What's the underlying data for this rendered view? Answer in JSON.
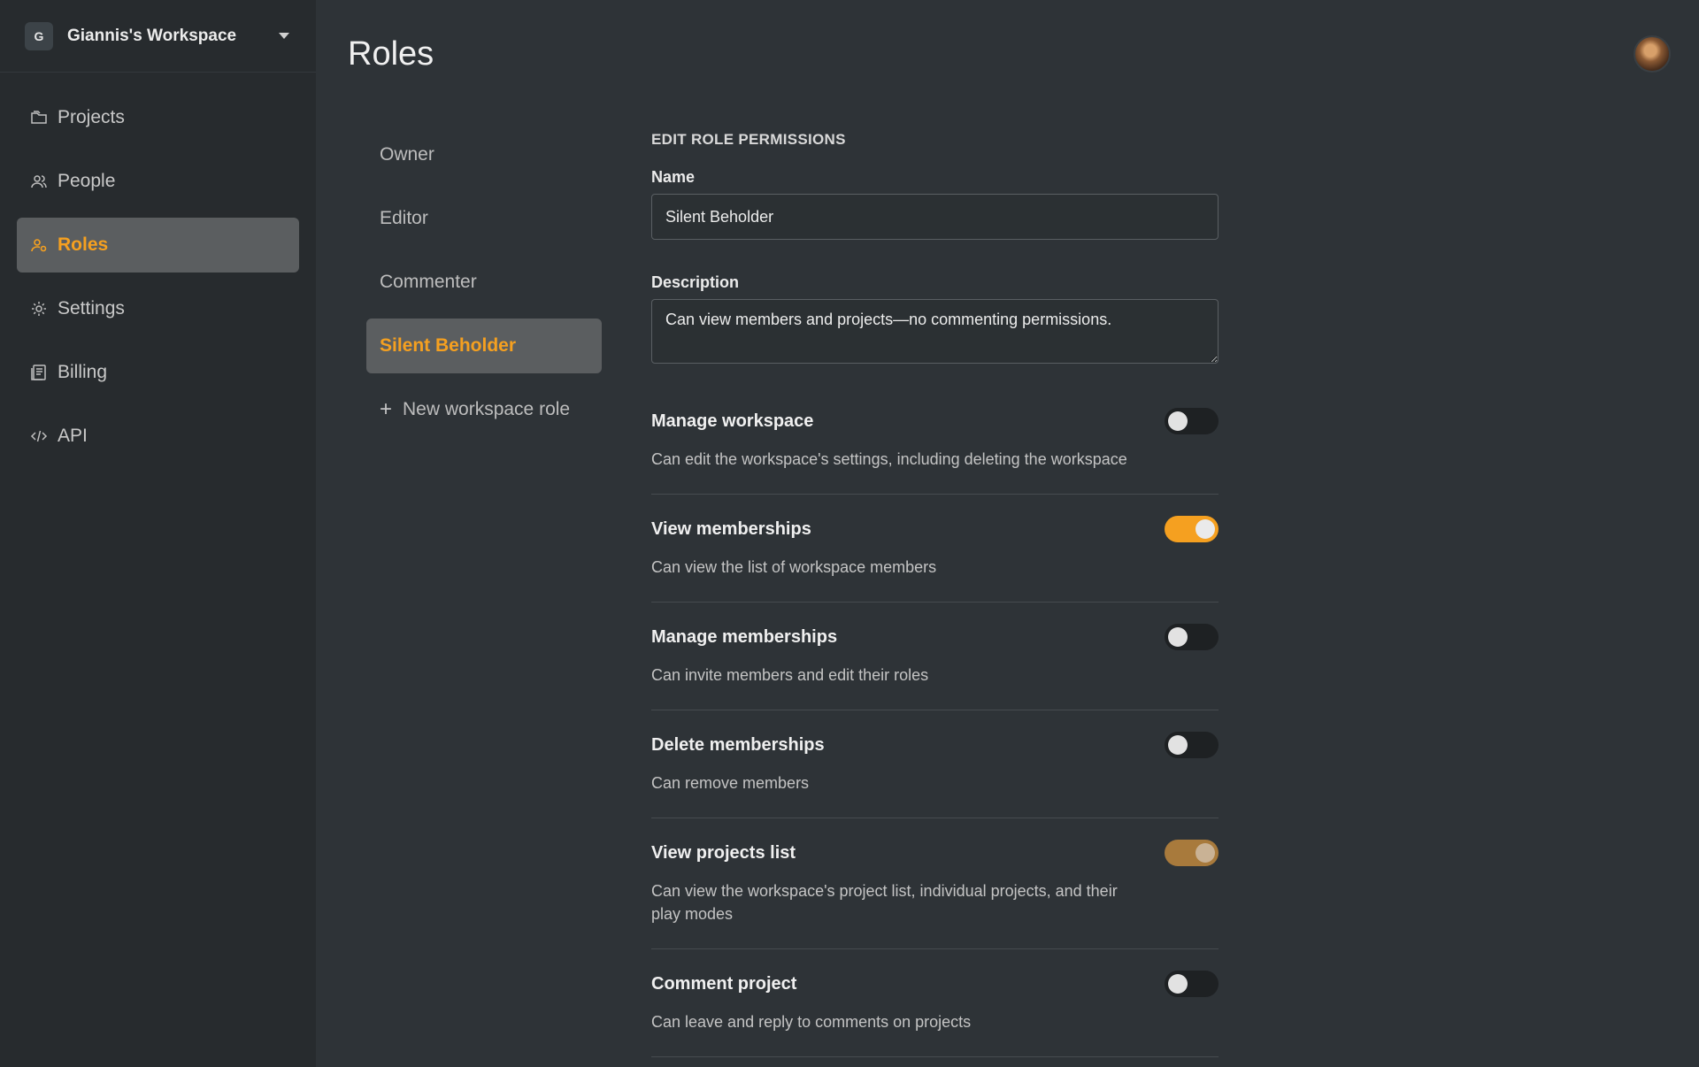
{
  "workspace": {
    "initial": "G",
    "name": "Giannis's Workspace"
  },
  "sidebar": {
    "items": [
      {
        "label": "Projects",
        "icon": "folder-icon"
      },
      {
        "label": "People",
        "icon": "people-icon"
      },
      {
        "label": "Roles",
        "icon": "role-icon",
        "active": true
      },
      {
        "label": "Settings",
        "icon": "gear-icon"
      },
      {
        "label": "Billing",
        "icon": "billing-icon"
      },
      {
        "label": "API",
        "icon": "code-icon"
      }
    ]
  },
  "page": {
    "title": "Roles"
  },
  "roles": {
    "items": [
      {
        "label": "Owner"
      },
      {
        "label": "Editor"
      },
      {
        "label": "Commenter"
      },
      {
        "label": "Silent Beholder",
        "active": true
      }
    ],
    "add_label": "New workspace role"
  },
  "form": {
    "section_title": "EDIT ROLE PERMISSIONS",
    "name_label": "Name",
    "name_value": "Silent Beholder",
    "description_label": "Description",
    "description_value": "Can view members and projects—no commenting permissions."
  },
  "permissions": [
    {
      "title": "Manage workspace",
      "desc": "Can edit the workspace's settings, including deleting the workspace",
      "enabled": false
    },
    {
      "title": "View memberships",
      "desc": "Can view the list of workspace members",
      "enabled": true
    },
    {
      "title": "Manage memberships",
      "desc": "Can invite members and edit their roles",
      "enabled": false
    },
    {
      "title": "Delete memberships",
      "desc": "Can remove members",
      "enabled": false
    },
    {
      "title": "View projects list",
      "desc": "Can view the workspace's project list, individual projects, and their play modes",
      "enabled": true,
      "locked": true
    },
    {
      "title": "Comment project",
      "desc": "Can leave and reply to comments on projects",
      "enabled": false
    }
  ],
  "colors": {
    "accent": "#f5a020",
    "sidebar_bg": "#272b2e",
    "main_bg": "#2e3337"
  }
}
